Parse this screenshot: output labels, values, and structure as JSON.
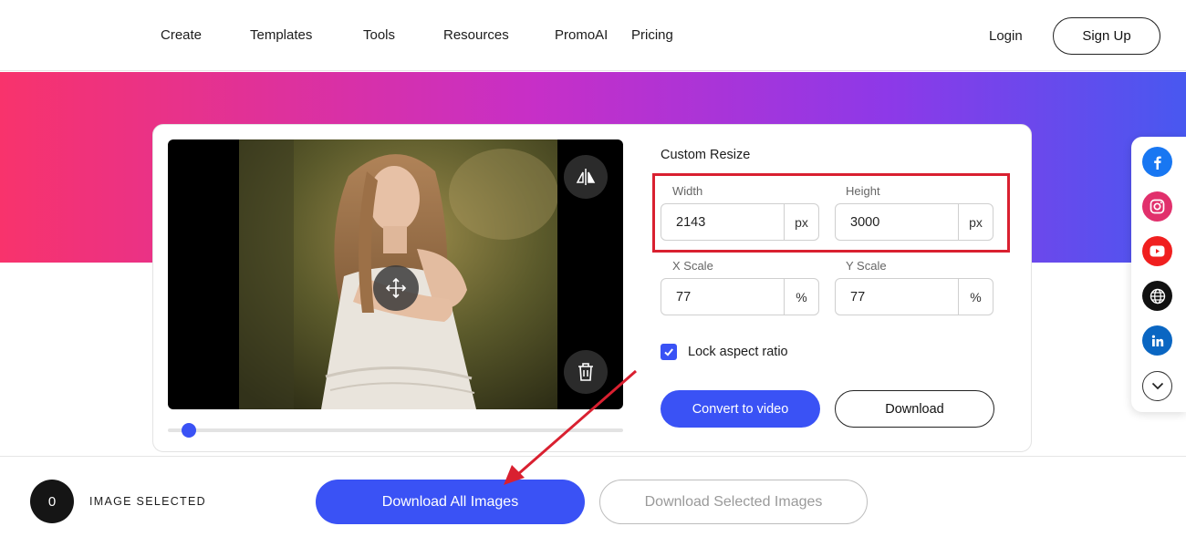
{
  "nav": {
    "items": [
      {
        "label": "Create"
      },
      {
        "label": "Templates"
      },
      {
        "label": "Tools"
      },
      {
        "label": "Resources"
      },
      {
        "label": "PromoAI"
      },
      {
        "label": "Pricing"
      }
    ],
    "login_label": "Login",
    "signup_label": "Sign Up"
  },
  "editor": {
    "preview_icons": [
      "move-icon",
      "flip-icon",
      "trash-icon"
    ],
    "zoom_slider_level": 0.05
  },
  "resize": {
    "title": "Custom Resize",
    "width": {
      "label": "Width",
      "value": "2143",
      "unit": "px"
    },
    "height": {
      "label": "Height",
      "value": "3000",
      "unit": "px"
    },
    "x_scale": {
      "label": "X Scale",
      "value": "77",
      "unit": "%"
    },
    "y_scale": {
      "label": "Y Scale",
      "value": "77",
      "unit": "%"
    },
    "lock_aspect_ratio": {
      "label": "Lock aspect ratio",
      "checked": true
    },
    "convert_label": "Convert to video",
    "download_label": "Download"
  },
  "social": {
    "icons": [
      "facebook-icon",
      "instagram-icon",
      "youtube-icon",
      "globe-icon",
      "linkedin-icon",
      "chevron-down-icon"
    ]
  },
  "bottom": {
    "selected_count": "0",
    "selected_label": "IMAGE SELECTED",
    "download_all_label": "Download All Images",
    "download_selected_label": "Download Selected Images"
  },
  "colors": {
    "accent": "#3a52f5",
    "banner_start": "#f8336c",
    "banner_end": "#4858f0",
    "highlight": "#d92030"
  }
}
